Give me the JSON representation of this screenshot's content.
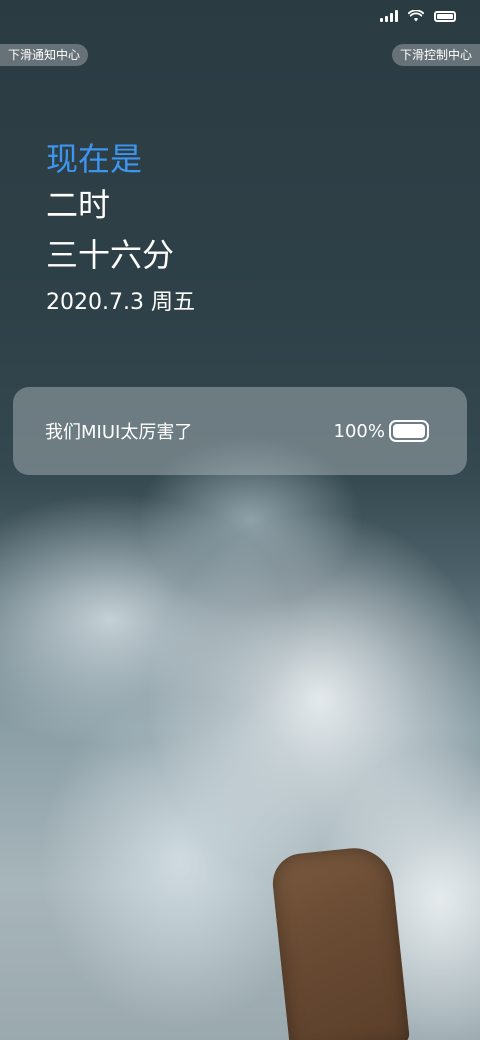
{
  "status_bar": {
    "icons": [
      "signal-icon",
      "wifi-icon",
      "battery-icon"
    ]
  },
  "hints": {
    "notification": "下滑通知中心",
    "control": "下滑控制中心"
  },
  "clock": {
    "prefix": "现在是",
    "hour": "二时",
    "minute": "三十六分",
    "date": "2020.7.3 周五"
  },
  "card": {
    "message": "我们MIUI太厉害了",
    "battery_percent": "100%",
    "battery_level": 1.0
  },
  "colors": {
    "accent": "#3d95ee",
    "text": "#ffffff"
  }
}
